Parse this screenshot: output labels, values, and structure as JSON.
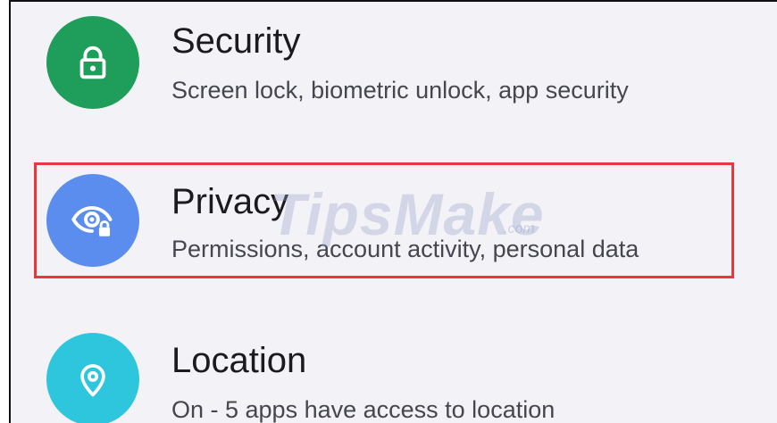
{
  "settings": {
    "items": [
      {
        "title": "Security",
        "subtitle": "Screen lock, biometric unlock, app security",
        "icon": "lock-icon",
        "color": "#1e9e5a"
      },
      {
        "title": "Privacy",
        "subtitle": "Permissions, account activity, personal data",
        "icon": "eye-lock-icon",
        "color": "#5b8def"
      },
      {
        "title": "Location",
        "subtitle": "On - 5 apps have access to location",
        "icon": "location-pin-icon",
        "color": "#2ec6dc"
      }
    ]
  },
  "annotation": {
    "highlight_color": "#e8383d"
  },
  "watermark": {
    "text": "TipsMake",
    "suffix": ".com"
  }
}
